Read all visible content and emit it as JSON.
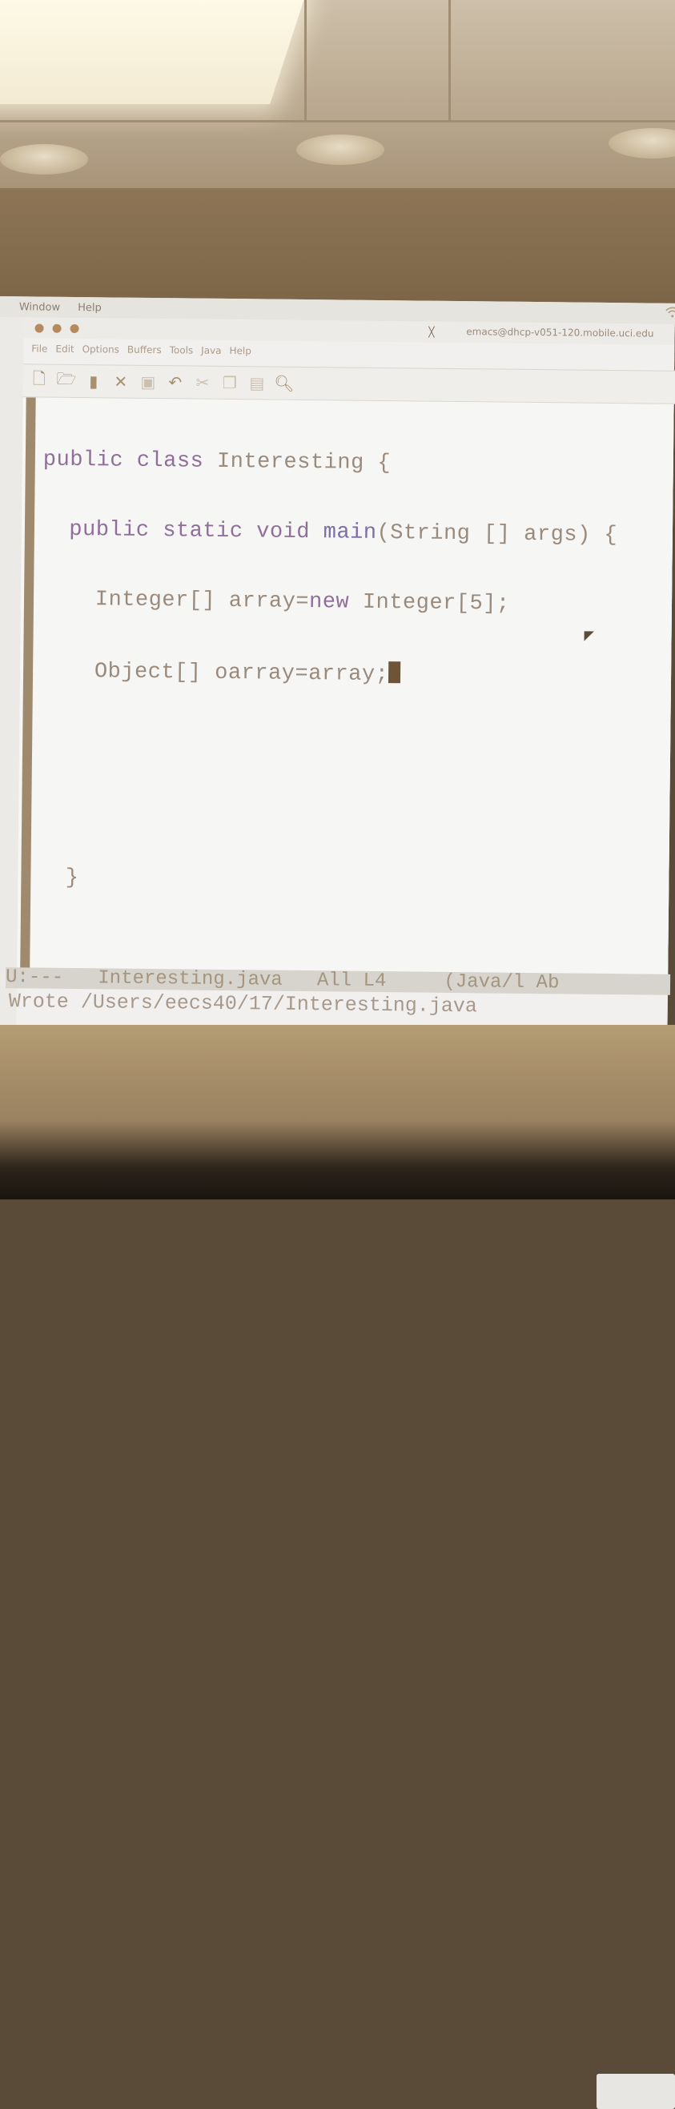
{
  "mac_menubar": {
    "items": [
      "Window",
      "Help"
    ]
  },
  "window": {
    "title": "emacs@dhcp-v051-120.mobile.uci.edu",
    "menu": [
      "File",
      "Edit",
      "Options",
      "Buffers",
      "Tools",
      "Java",
      "Help"
    ],
    "toolbar_icons": [
      "new-file-icon",
      "open-folder-icon",
      "save-icon",
      "close-icon",
      "save-as-icon",
      "undo-icon",
      "cut-icon",
      "copy-icon",
      "paste-icon",
      "search-icon"
    ]
  },
  "editor": {
    "lines": [
      [
        "public",
        " ",
        "class",
        " Interesting {"
      ],
      [
        "  ",
        "public",
        " ",
        "static",
        " ",
        "void",
        " ",
        "main",
        "(String [] args) {"
      ],
      [
        "    Integer[] array=",
        "new",
        " Integer[5];"
      ],
      [
        "    Object[] oarray=array;"
      ],
      [
        ""
      ],
      [
        ""
      ],
      [
        "  }"
      ],
      [
        ""
      ],
      [
        ""
      ],
      [
        "}"
      ]
    ]
  },
  "modeline": {
    "status": "U:---",
    "buffer_name": "Interesting.java",
    "position": "All L4",
    "mode": "(Java/l Ab"
  },
  "minibuffer": {
    "message": "Wrote /Users/eecs40/17/Interesting.java"
  }
}
